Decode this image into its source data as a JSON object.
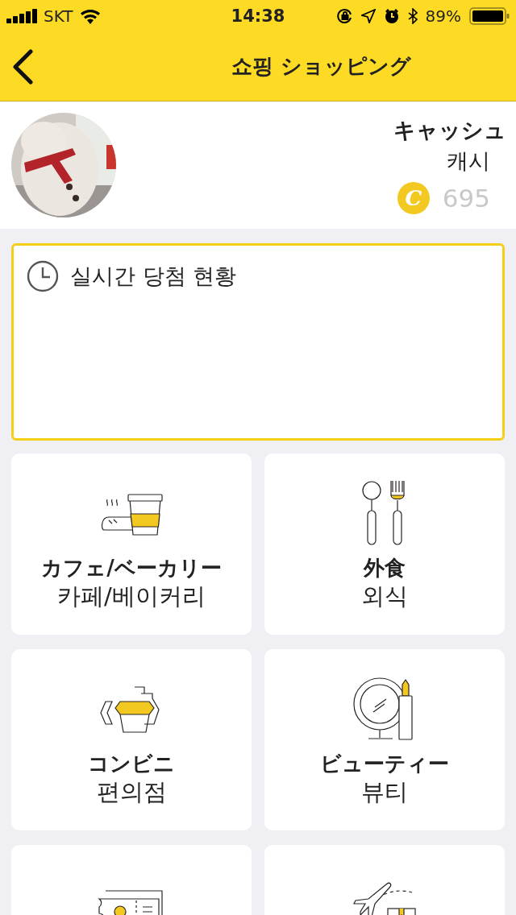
{
  "status_bar": {
    "carrier": "SKT",
    "time": "14:38",
    "battery": "89%"
  },
  "nav": {
    "title": "쇼핑 ショッピング"
  },
  "profile": {
    "label_ja": "キャッシュ",
    "label_ko": "캐시",
    "coin_symbol": "C",
    "balance": "695"
  },
  "live_box": {
    "title": "실시간 당첨 현황"
  },
  "categories": [
    {
      "kind": "cafe",
      "title_ja": "カフェ/ベーカリー",
      "title_ko": "카페/베이커리"
    },
    {
      "kind": "dining",
      "title_ja": "外食",
      "title_ko": "외식"
    },
    {
      "kind": "convenience",
      "title_ja": "コンビニ",
      "title_ko": "편의점"
    },
    {
      "kind": "beauty",
      "title_ja": "ビューティー",
      "title_ko": "뷰티"
    },
    {
      "kind": "ticket"
    },
    {
      "kind": "travel"
    }
  ]
}
